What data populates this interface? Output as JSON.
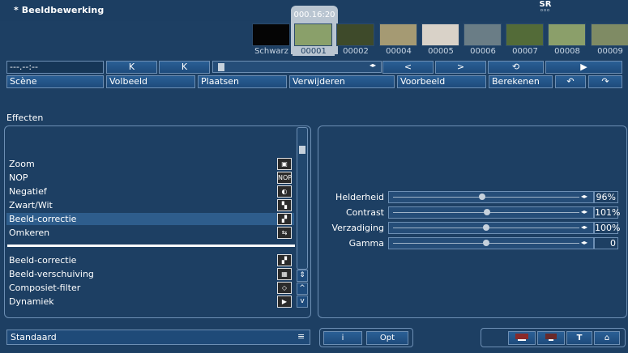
{
  "app": {
    "title": "* Beeldbewerking",
    "logo_text": "SR",
    "logo_sub": "ooo"
  },
  "filmstrip": {
    "timecode": "000.16:20",
    "clips": [
      {
        "label": "Schwarz",
        "color": "#050505"
      },
      {
        "label": "00001",
        "color": "#8aa06a",
        "selected": true
      },
      {
        "label": "00002",
        "color": "#3e4a2a"
      },
      {
        "label": "00004",
        "color": "#a59a73"
      },
      {
        "label": "00005",
        "color": "#d9d2c8"
      },
      {
        "label": "00006",
        "color": "#6a7d86"
      },
      {
        "label": "00007",
        "color": "#536b38"
      },
      {
        "label": "00008",
        "color": "#8b9f6a"
      },
      {
        "label": "00009",
        "color": "#7f8b64"
      }
    ]
  },
  "toolbar": {
    "time_field": "---.--:--",
    "skip_start_icon": "K",
    "skip_end_icon": "K",
    "slider_arrows": "◂▸",
    "prev_icon": "<",
    "next_icon": ">",
    "loop_icon": "⟲",
    "play_icon": "▶",
    "scene_label": "Scène",
    "fullscreen_label": "Volbeeld",
    "place_label": "Plaatsen",
    "remove_label": "Verwijderen",
    "preview_label": "Voorbeeld",
    "calculate_label": "Berekenen",
    "undo_icon": "↶",
    "redo_icon": "↷"
  },
  "effects": {
    "section_title": "Effecten",
    "top_items": [
      {
        "label": "Zoom",
        "icon": "zoom-icon",
        "glyph": "▣"
      },
      {
        "label": "NOP",
        "icon": "nop-icon",
        "glyph": "NOP"
      },
      {
        "label": "Negatief",
        "icon": "negative-icon",
        "glyph": "◐"
      },
      {
        "label": "Zwart/Wit",
        "icon": "black-white-icon",
        "glyph": "▚"
      },
      {
        "label": "Beeld-correctie",
        "icon": "image-correction-icon",
        "glyph": "▞",
        "selected": true
      },
      {
        "label": "Omkeren",
        "icon": "flip-icon",
        "glyph": "⇆"
      }
    ],
    "bottom_items": [
      {
        "label": "Beeld-correctie",
        "icon": "image-correction-icon",
        "glyph": "▞"
      },
      {
        "label": "Beeld-verschuiving",
        "icon": "image-shift-icon",
        "glyph": "▦"
      },
      {
        "label": "Composiet-filter",
        "icon": "composite-filter-icon",
        "glyph": "◇"
      },
      {
        "label": "Dynamiek",
        "icon": "dynamics-icon",
        "glyph": "▶"
      }
    ],
    "scroll_updown": "⇕",
    "scroll_up": "^",
    "scroll_down": "v"
  },
  "params": [
    {
      "label": "Helderheid",
      "value": "96%",
      "level": 0.48
    },
    {
      "label": "Contrast",
      "value": "101%",
      "level": 0.505
    },
    {
      "label": "Verzadiging",
      "value": "100%",
      "level": 0.5
    },
    {
      "label": "Gamma",
      "value": "0",
      "level": 0.5
    }
  ],
  "bottom": {
    "preset_label": "Standaard",
    "menu_icon": "≡",
    "info_label": "i",
    "opt_label": "Opt",
    "text_icon": "T",
    "home_icon": "⌂"
  },
  "colors": {
    "background": "#1d3f63",
    "accent": "#2e5d8c",
    "border": "#6d8fb4"
  }
}
